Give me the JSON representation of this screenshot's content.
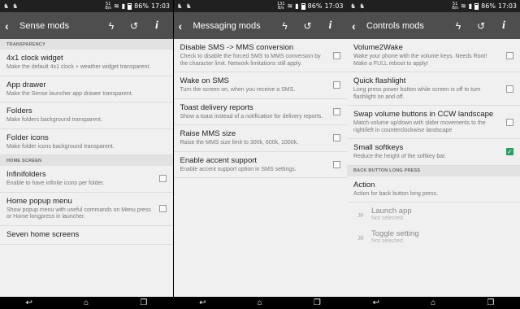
{
  "screens": [
    {
      "status": {
        "speed": "51\nB/s",
        "battery": "86%",
        "time": "17:03"
      },
      "title": "Sense mods",
      "sections": [
        {
          "header": "TRANSPARENCY",
          "items": [
            {
              "title": "4x1 clock widget",
              "subtitle": "Make the default 4x1 clock + weather widget transparent.",
              "checkbox": null
            },
            {
              "title": "App drawer",
              "subtitle": "Make the Sense launcher app drawer transparent.",
              "checkbox": null
            },
            {
              "title": "Folders",
              "subtitle": "Make folders background transparent.",
              "checkbox": null
            },
            {
              "title": "Folder icons",
              "subtitle": "Make folder icons background transparent.",
              "checkbox": null
            }
          ]
        },
        {
          "header": "HOME SCREEN",
          "items": [
            {
              "title": "Infinifolders",
              "subtitle": "Enable to have infinite icons per folder.",
              "checkbox": false
            },
            {
              "title": "Home popup menu",
              "subtitle": "Show popup menu with useful commands on Menu press or Home longpress in launcher.",
              "checkbox": false
            },
            {
              "title": "Seven home screens",
              "subtitle": "",
              "checkbox": null
            }
          ]
        }
      ]
    },
    {
      "status": {
        "speed": "131\nB/s",
        "battery": "86%",
        "time": "17:03"
      },
      "title": "Messaging mods",
      "sections": [
        {
          "header": "",
          "items": [
            {
              "title": "Disable SMS -> MMS conversion",
              "subtitle": "Check to disable the forced SMS to MMS conversion by the character limit. Network limitations still apply.",
              "checkbox": false
            },
            {
              "title": "Wake on SMS",
              "subtitle": "Turn the screen on, when you receive a SMS.",
              "checkbox": false
            },
            {
              "title": "Toast delivery reports",
              "subtitle": "Show a toast instead of a notification for delivery reports.",
              "checkbox": false
            },
            {
              "title": "Raise MMS size",
              "subtitle": "Raise the MMS size limit to 300k, 600k, 1000k.",
              "checkbox": false
            },
            {
              "title": "Enable accent support",
              "subtitle": "Enable accent support option in SMS settings.",
              "checkbox": false
            }
          ]
        }
      ]
    },
    {
      "status": {
        "speed": "51\nB/s",
        "battery": "86%",
        "time": "17:03"
      },
      "title": "Controls mods",
      "sections": [
        {
          "header": "",
          "items": [
            {
              "title": "Volume2Wake",
              "subtitle": "Wake your phone with the volume keys. Needs Root! Make a FULL reboot to apply!",
              "checkbox": false
            },
            {
              "title": "Quick flashlight",
              "subtitle": "Long press power button while screen is off to turn flashlight on and off.",
              "checkbox": false
            },
            {
              "title": "Swap volume buttons in CCW landscape",
              "subtitle": "Match volume up/down with slider movements to the right/left in counterclockwise landscape",
              "checkbox": false
            },
            {
              "title": "Small softkeys",
              "subtitle": "Reduce the height of the softkey bar.",
              "checkbox": true
            }
          ]
        },
        {
          "header": "BACK BUTTON LONG PRESS",
          "items": [
            {
              "title": "Action",
              "subtitle": "Action for back button long press.",
              "checkbox": null
            }
          ],
          "sub_items": [
            {
              "title": "Launch app",
              "subtitle": "Not selected"
            },
            {
              "title": "Toggle setting",
              "subtitle": "Not selected"
            }
          ]
        }
      ]
    }
  ],
  "icons": {
    "back": "chevron-left",
    "flash": "bolt",
    "history": "history",
    "info": "info"
  },
  "colors": {
    "toolbar": "#4e4e4e",
    "status": "#202020",
    "accent": "#2e9c61"
  }
}
